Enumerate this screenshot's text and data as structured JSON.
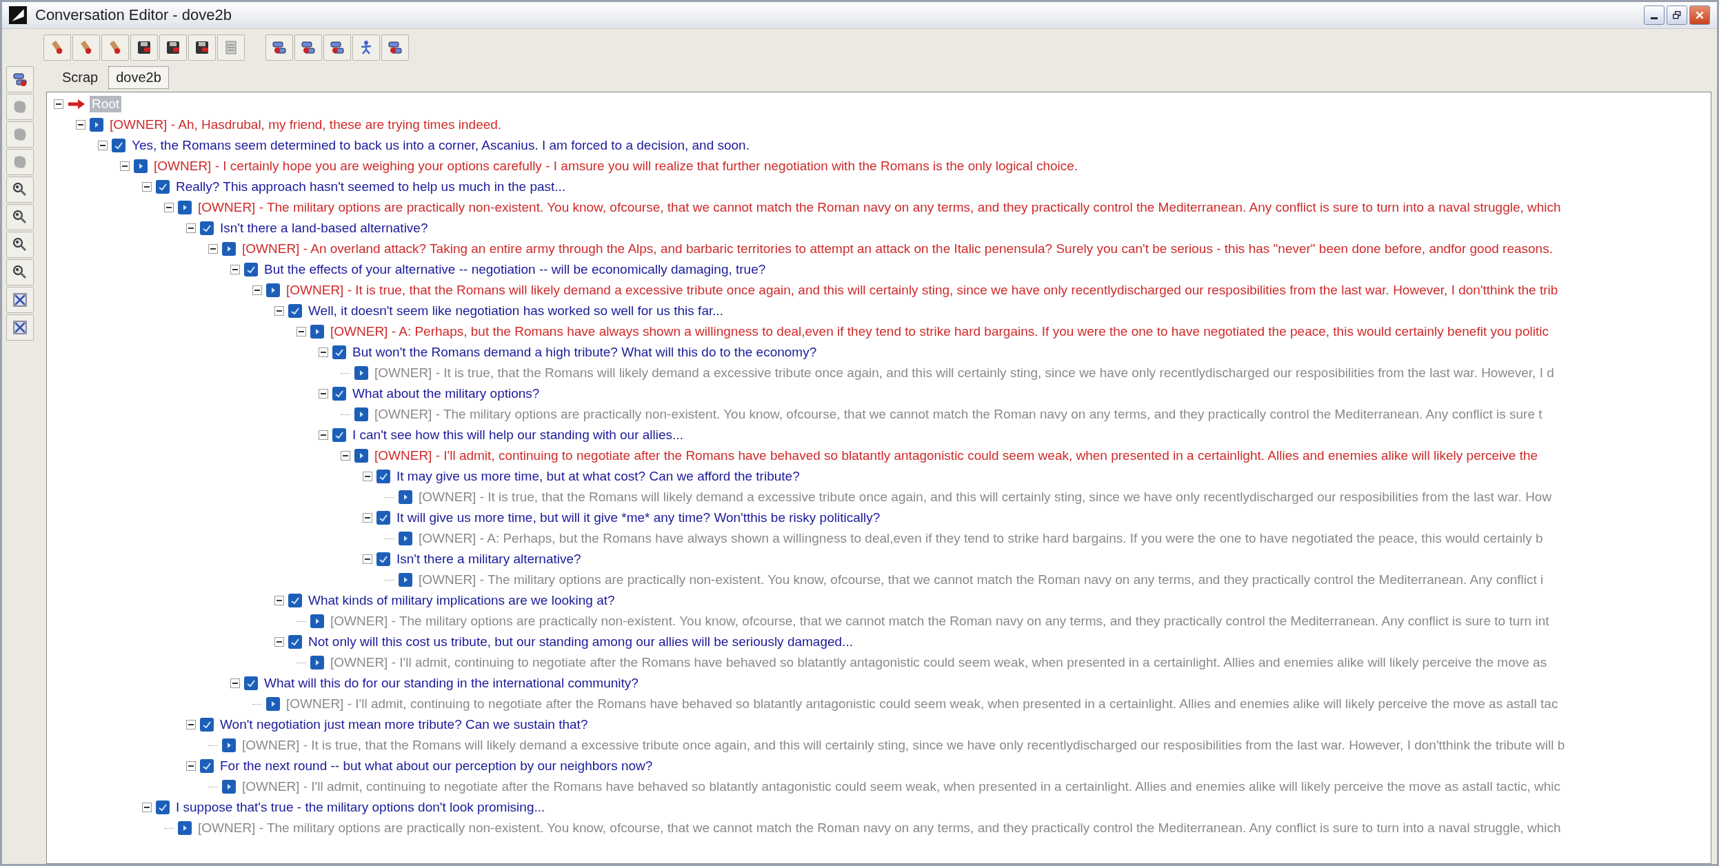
{
  "window": {
    "title": "Conversation Editor - dove2b"
  },
  "tabs": [
    {
      "label": "Scrap",
      "selected": false
    },
    {
      "label": "dove2b",
      "selected": true
    }
  ],
  "tree": [
    {
      "kind": "root",
      "text": "Root",
      "selected": true,
      "expanded": true,
      "children": [
        {
          "kind": "owner",
          "text": "[OWNER] - Ah, Hasdrubal, my friend, these are trying times indeed.",
          "selected": false,
          "expanded": true,
          "children": [
            {
              "kind": "player",
              "text": "Yes, the Romans seem determined to back us into a corner, Ascanius.  I am forced to a decision, and soon.",
              "selected": false,
              "expanded": true,
              "children": [
                {
                  "kind": "owner",
                  "text": "[OWNER] - I certainly hope you are weighing your options carefully - I amsure you will realize that further negotiation with the Romans is the only logical choice.",
                  "selected": false,
                  "expanded": true,
                  "children": [
                    {
                      "kind": "player",
                      "text": "Really? This approach hasn't seemed to help us much in the past...",
                      "selected": false,
                      "expanded": true,
                      "children": [
                        {
                          "kind": "owner",
                          "text": "[OWNER] - The military options are practically non-existent. You know, ofcourse, that we cannot match the Roman navy on any terms, and they practically control the Mediterranean. Any conflict is sure to turn into a naval struggle, which",
                          "selected": false,
                          "expanded": true,
                          "children": [
                            {
                              "kind": "player",
                              "text": "Isn't there a land-based alternative?",
                              "selected": false,
                              "expanded": true,
                              "children": [
                                {
                                  "kind": "owner",
                                  "text": "[OWNER] - An overland attack? Taking an entire army through the Alps, and barbaric territories to attempt an attack on the Italic penensula? Surely you can't be serious - this has \"never\" been done before, andfor good reasons.",
                                  "selected": false,
                                  "expanded": true,
                                  "children": [
                                    {
                                      "kind": "player",
                                      "text": "But the effects of your alternative -- negotiation -- will be economically damaging, true?",
                                      "selected": false,
                                      "expanded": true,
                                      "children": [
                                        {
                                          "kind": "owner",
                                          "text": "[OWNER] - It is true, that the Romans will likely demand a excessive tribute once again, and this will certainly sting, since we have only recentlydischarged our resposibilities from the last war. However, I don'tthink the trib",
                                          "selected": false,
                                          "expanded": true,
                                          "children": [
                                            {
                                              "kind": "player",
                                              "text": "Well, it doesn't seem like negotiation has worked so well for us this far...",
                                              "selected": false,
                                              "expanded": true,
                                              "children": [
                                                {
                                                  "kind": "owner",
                                                  "text": "[OWNER] - A: Perhaps, but the Romans have always shown a willingness to deal,even if they tend to strike hard bargains. If you were the one to have negotiated the peace, this would certainly benefit you politic",
                                                  "selected": false,
                                                  "expanded": true,
                                                  "children": [
                                                    {
                                                      "kind": "player",
                                                      "text": "But won't the Romans demand a high tribute? What will this do to the economy?",
                                                      "selected": false,
                                                      "expanded": true,
                                                      "children": [
                                                        {
                                                          "kind": "link",
                                                          "text": "[OWNER] - It is true, that the Romans will likely demand a excessive tribute once again, and this will certainly sting, since we have only recentlydischarged our resposibilities from the last war. However, I d",
                                                          "selected": false
                                                        }
                                                      ]
                                                    },
                                                    {
                                                      "kind": "player",
                                                      "text": "What about the military options?",
                                                      "selected": false,
                                                      "expanded": true,
                                                      "children": [
                                                        {
                                                          "kind": "link",
                                                          "text": "[OWNER] - The military options are practically non-existent. You know, ofcourse, that we cannot match the Roman navy on any terms, and they practically control the Mediterranean. Any conflict is sure t",
                                                          "selected": false
                                                        }
                                                      ]
                                                    },
                                                    {
                                                      "kind": "player",
                                                      "text": "I can't see how this will help our standing with our allies...",
                                                      "selected": false,
                                                      "expanded": true,
                                                      "children": [
                                                        {
                                                          "kind": "owner",
                                                          "text": "[OWNER] - I'll admit, continuing to negotiate after the Romans have behaved so blatantly antagonistic could seem weak, when presented in a certainlight. Allies and enemies alike will likely perceive the",
                                                          "selected": false,
                                                          "expanded": true,
                                                          "children": [
                                                            {
                                                              "kind": "player",
                                                              "text": "It may give us more time, but at what cost? Can we afford the tribute?",
                                                              "selected": false,
                                                              "expanded": true,
                                                              "children": [
                                                                {
                                                                  "kind": "link",
                                                                  "text": "[OWNER] - It is true, that the Romans will likely demand a excessive tribute once again, and this will certainly sting, since we have only recentlydischarged our resposibilities from the last war. How",
                                                                  "selected": false
                                                                }
                                                              ]
                                                            },
                                                            {
                                                              "kind": "player",
                                                              "text": "It will give us more time, but will it give *me* any time? Won'tthis be risky politically?",
                                                              "selected": false,
                                                              "expanded": true,
                                                              "children": [
                                                                {
                                                                  "kind": "link",
                                                                  "text": "[OWNER] - A: Perhaps, but the Romans have always shown a willingness to deal,even if they tend to strike hard bargains. If you were the one to have negotiated the peace, this would certainly b",
                                                                  "selected": false
                                                                }
                                                              ]
                                                            },
                                                            {
                                                              "kind": "player",
                                                              "text": "Isn't there a military alternative?",
                                                              "selected": false,
                                                              "expanded": true,
                                                              "children": [
                                                                {
                                                                  "kind": "link",
                                                                  "text": "[OWNER] - The military options are practically non-existent. You know, ofcourse, that we cannot match the Roman navy on any terms, and they practically control the Mediterranean. Any conflict i",
                                                                  "selected": false
                                                                }
                                                              ]
                                                            }
                                                          ]
                                                        }
                                                      ]
                                                    }
                                                  ]
                                                }
                                              ]
                                            },
                                            {
                                              "kind": "player",
                                              "text": "What kinds of military implications are we looking at?",
                                              "selected": false,
                                              "expanded": true,
                                              "children": [
                                                {
                                                  "kind": "link",
                                                  "text": "[OWNER] - The military options are practically non-existent. You know, ofcourse, that we cannot match the Roman navy on any terms, and they practically control the Mediterranean. Any conflict is sure to turn int",
                                                  "selected": false
                                                }
                                              ]
                                            },
                                            {
                                              "kind": "player",
                                              "text": "Not only will this cost us tribute, but our standing among our allies will be seriously damaged...",
                                              "selected": false,
                                              "expanded": true,
                                              "children": [
                                                {
                                                  "kind": "link",
                                                  "text": "[OWNER] - I'll admit, continuing to negotiate after the Romans have behaved so blatantly antagonistic could seem weak, when presented in a certainlight. Allies and enemies alike will likely perceive the move as",
                                                  "selected": false
                                                }
                                              ]
                                            }
                                          ]
                                        }
                                      ]
                                    },
                                    {
                                      "kind": "player",
                                      "text": "What will this do for our standing in the international community?",
                                      "selected": false,
                                      "expanded": true,
                                      "children": [
                                        {
                                          "kind": "link",
                                          "text": "[OWNER] - I'll admit, continuing to negotiate after the Romans have behaved so blatantly antagonistic could seem weak, when presented in a certainlight. Allies and enemies alike will likely perceive the move as astall tac",
                                          "selected": false
                                        }
                                      ]
                                    }
                                  ]
                                }
                              ]
                            },
                            {
                              "kind": "player",
                              "text": "Won't negotiation just mean more tribute? Can we sustain that?",
                              "selected": false,
                              "expanded": true,
                              "children": [
                                {
                                  "kind": "link",
                                  "text": "[OWNER] - It is true, that the Romans will likely demand a excessive tribute once again, and this will certainly sting, since we have only recentlydischarged our resposibilities from the last war. However, I don'tthink the tribute will b",
                                  "selected": false
                                }
                              ]
                            },
                            {
                              "kind": "player",
                              "text": "For the next round -- but what about our perception by our neighbors now?",
                              "selected": false,
                              "expanded": true,
                              "children": [
                                {
                                  "kind": "link",
                                  "text": "[OWNER] - I'll admit, continuing to negotiate after the Romans have behaved so blatantly antagonistic could seem weak, when presented in a certainlight. Allies and enemies alike will likely perceive the move as astall tactic, whic",
                                  "selected": false
                                }
                              ]
                            }
                          ]
                        }
                      ]
                    },
                    {
                      "kind": "player",
                      "text": "I suppose that's true - the military options don't look promising...",
                      "selected": false,
                      "expanded": true,
                      "children": [
                        {
                          "kind": "link",
                          "text": "[OWNER] - The military options are practically non-existent. You know, ofcourse, that we cannot match the Roman navy on any terms, and they practically control the Mediterranean. Any conflict is sure to turn into a naval struggle, which",
                          "selected": false
                        }
                      ]
                    }
                  ]
                }
              ]
            }
          ]
        }
      ]
    }
  ]
}
